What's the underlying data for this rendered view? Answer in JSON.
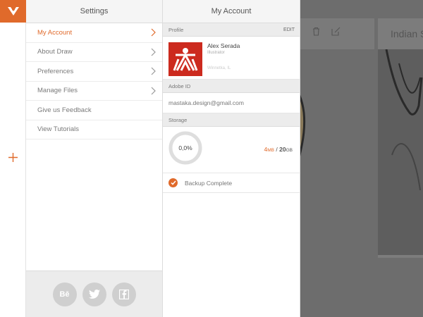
{
  "colors": {
    "accent": "#e06a2b",
    "avatar_bg": "#cc2a1e"
  },
  "rail": {
    "logo_icon": "adobe-draw-logo-icon",
    "add_icon": "plus-icon"
  },
  "settings": {
    "title": "Settings",
    "items": [
      {
        "label": "My Account",
        "active": true,
        "chevron": true
      },
      {
        "label": "About Draw",
        "active": false,
        "chevron": true
      },
      {
        "label": "Preferences",
        "active": false,
        "chevron": true
      },
      {
        "label": "Manage Files",
        "active": false,
        "chevron": true
      },
      {
        "label": "Give us Feedback",
        "active": false,
        "chevron": false
      },
      {
        "label": "View Tutorials",
        "active": false,
        "chevron": false
      }
    ],
    "social": [
      {
        "label": "Bē",
        "icon": "behance-icon"
      },
      {
        "label": "",
        "icon": "twitter-icon"
      },
      {
        "label": "",
        "icon": "facebook-icon"
      }
    ]
  },
  "account": {
    "title": "My Account",
    "profile_header": "Profile",
    "edit_label": "EDIT",
    "name": "Alex Serada",
    "role": "Illustrator",
    "location": "Winnetka, IL",
    "adobe_id_header": "Adobe ID",
    "email": "mastaka.design@gmail.com",
    "storage_header": "Storage",
    "storage_percent": "0,0%",
    "storage_used": "4",
    "storage_used_unit": "MB",
    "storage_total": "20",
    "storage_total_unit": "GB",
    "backup_label": "Backup Complete"
  },
  "background": {
    "title": "Indian S",
    "toolbar_icons": [
      "trash-icon",
      "edit-icon"
    ]
  }
}
